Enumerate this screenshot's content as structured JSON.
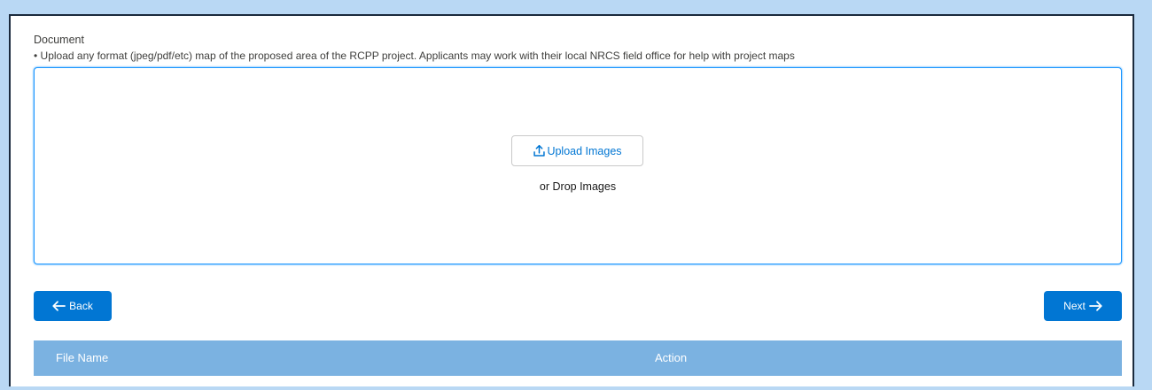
{
  "document": {
    "label": "Document",
    "help_text": "• Upload any format (jpeg/pdf/etc) map of the proposed area of the RCPP project. Applicants may work with their local NRCS field office for help with project maps"
  },
  "dropzone": {
    "upload_label": "Upload Images",
    "drop_text": "or Drop Images",
    "upload_icon": "upload-icon"
  },
  "navigation": {
    "back_label": "Back",
    "next_label": "Next",
    "back_icon": "arrow-left-icon",
    "next_icon": "arrow-right-icon"
  },
  "table": {
    "columns": [
      "File Name",
      "Action"
    ]
  },
  "colors": {
    "background": "#b9d8f4",
    "brand_blue": "#0176d3",
    "table_header": "#7bb2e1",
    "dropzone_border": "#1b96ff"
  }
}
